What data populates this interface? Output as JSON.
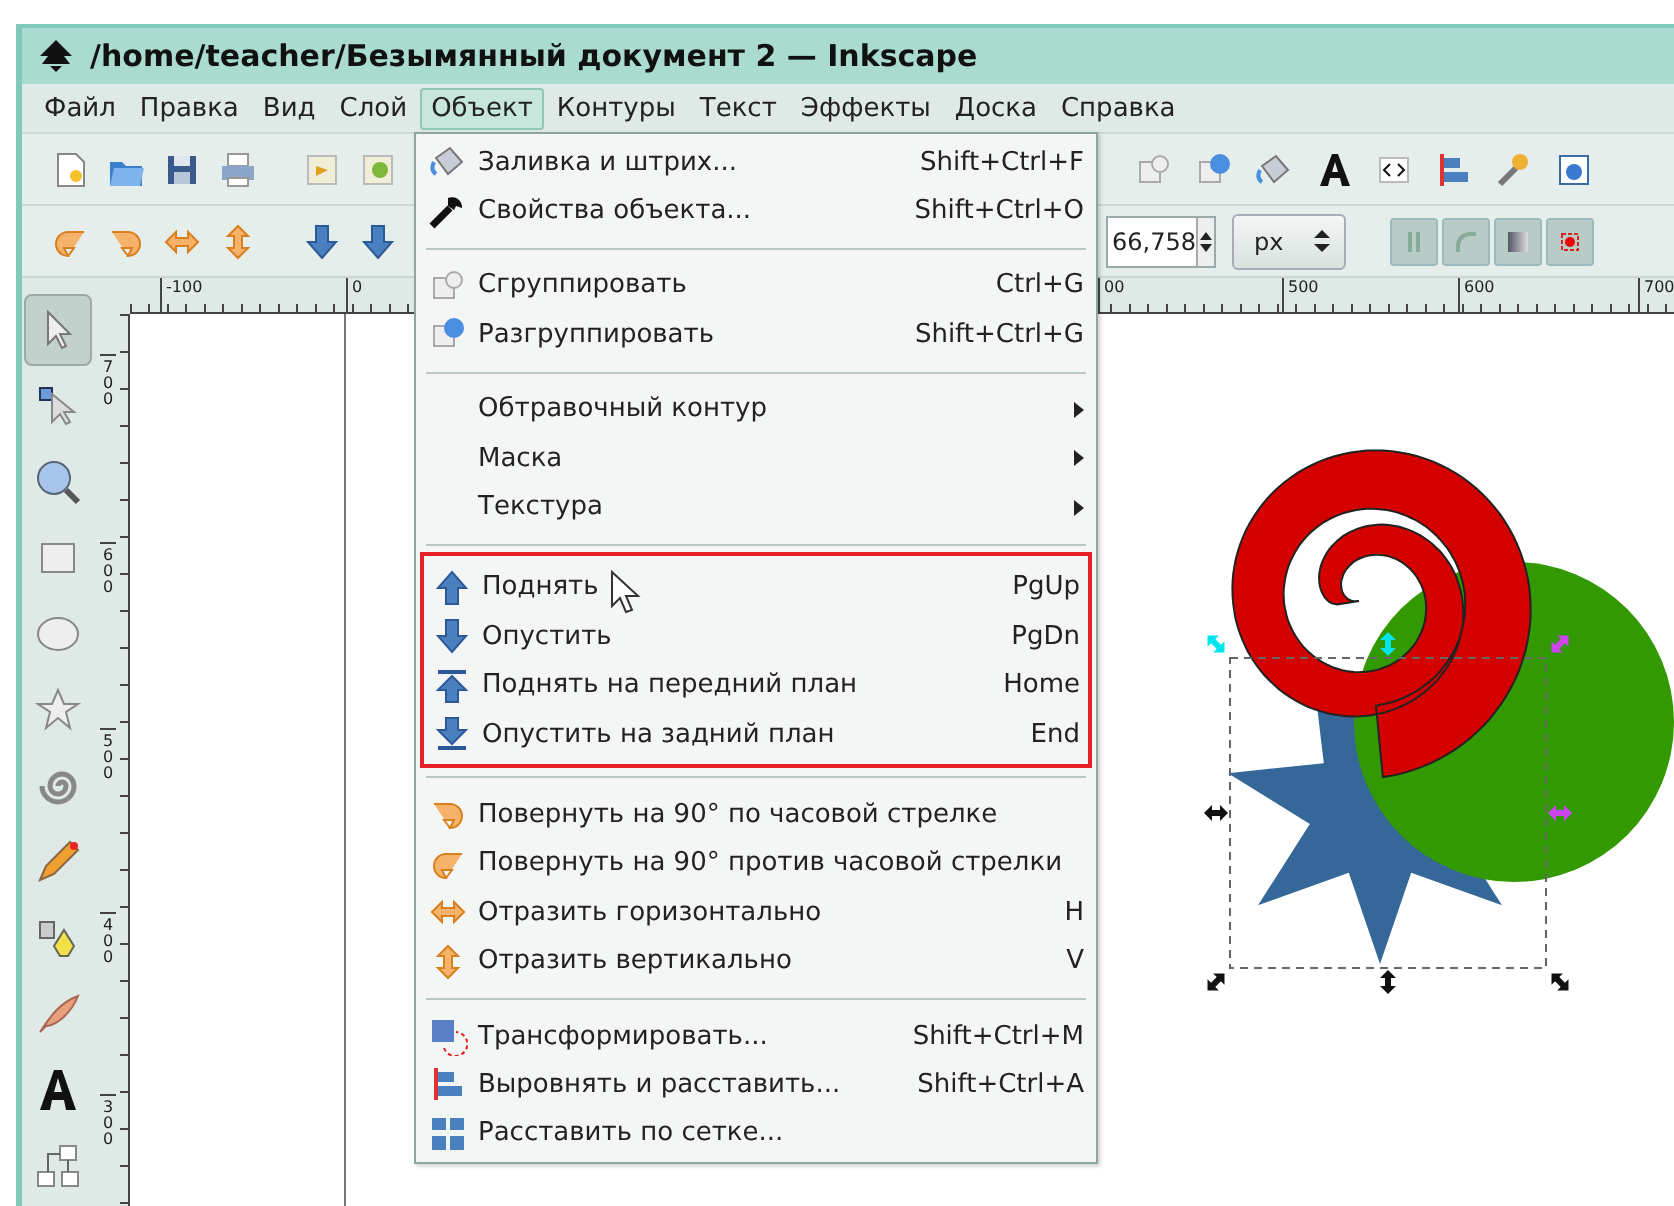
{
  "window": {
    "title": "/home/teacher/Безымянный документ 2 — Inkscape"
  },
  "menubar": [
    {
      "label": "Файл",
      "selected": false
    },
    {
      "label": "Правка",
      "selected": false
    },
    {
      "label": "Вид",
      "selected": false
    },
    {
      "label": "Слой",
      "selected": false
    },
    {
      "label": "Объект",
      "selected": true
    },
    {
      "label": "Контуры",
      "selected": false
    },
    {
      "label": "Текст",
      "selected": false
    },
    {
      "label": "Эффекты",
      "selected": false
    },
    {
      "label": "Доска",
      "selected": false
    },
    {
      "label": "Справка",
      "selected": false
    }
  ],
  "toolbar_controls": {
    "x_field": {
      "value": "66,758"
    },
    "unit_select": {
      "value": "px"
    }
  },
  "rulers": {
    "horizontal": [
      "-100",
      "0",
      "00",
      "500",
      "600",
      "700"
    ],
    "vertical": [
      "700",
      "600",
      "500",
      "400",
      "300"
    ]
  },
  "tools": [
    {
      "selected": true
    },
    {
      "selected": false
    },
    {
      "selected": false
    },
    {
      "selected": false
    },
    {
      "selected": false
    },
    {
      "selected": false
    },
    {
      "selected": false
    },
    {
      "selected": false
    },
    {
      "selected": false
    },
    {
      "selected": false
    },
    {
      "selected": false
    },
    {
      "selected": false
    }
  ],
  "object_menu": {
    "sections": [
      {
        "framed": false,
        "items": [
          {
            "kind": "command",
            "label": "Заливка и штрих...",
            "shortcut": "Shift+Ctrl+F"
          },
          {
            "kind": "command",
            "label": "Свойства объекта...",
            "shortcut": "Shift+Ctrl+O"
          }
        ]
      },
      {
        "framed": false,
        "items": [
          {
            "kind": "command",
            "label": "Сгруппировать",
            "shortcut": "Ctrl+G"
          },
          {
            "kind": "command",
            "label": "Разгруппировать",
            "shortcut": "Shift+Ctrl+G"
          }
        ]
      },
      {
        "framed": false,
        "items": [
          {
            "kind": "submenu",
            "label": "Обтравочный контур"
          },
          {
            "kind": "submenu",
            "label": "Маска"
          },
          {
            "kind": "submenu",
            "label": "Текстура"
          }
        ]
      },
      {
        "framed": true,
        "items": [
          {
            "kind": "command",
            "label": "Поднять",
            "shortcut": "PgUp"
          },
          {
            "kind": "command",
            "label": "Опустить",
            "shortcut": "PgDn"
          },
          {
            "kind": "command",
            "label": "Поднять на передний план",
            "shortcut": "Home"
          },
          {
            "kind": "command",
            "label": "Опустить на задний план",
            "shortcut": "End"
          }
        ]
      },
      {
        "framed": false,
        "items": [
          {
            "kind": "command",
            "label": "Повернуть на 90° по часовой стрелке"
          },
          {
            "kind": "command",
            "label": "Повернуть на 90° против часовой стрелки"
          },
          {
            "kind": "command",
            "label": "Отразить горизонтально",
            "shortcut": "H"
          },
          {
            "kind": "command",
            "label": "Отразить вертикально",
            "shortcut": "V"
          }
        ]
      },
      {
        "framed": false,
        "items": [
          {
            "kind": "command",
            "label": "Трансформировать...",
            "shortcut": "Shift+Ctrl+M"
          },
          {
            "kind": "command",
            "label": "Выровнять и расставить...",
            "shortcut": "Shift+Ctrl+A"
          },
          {
            "kind": "command",
            "label": "Расставить по сетке..."
          }
        ]
      }
    ]
  }
}
